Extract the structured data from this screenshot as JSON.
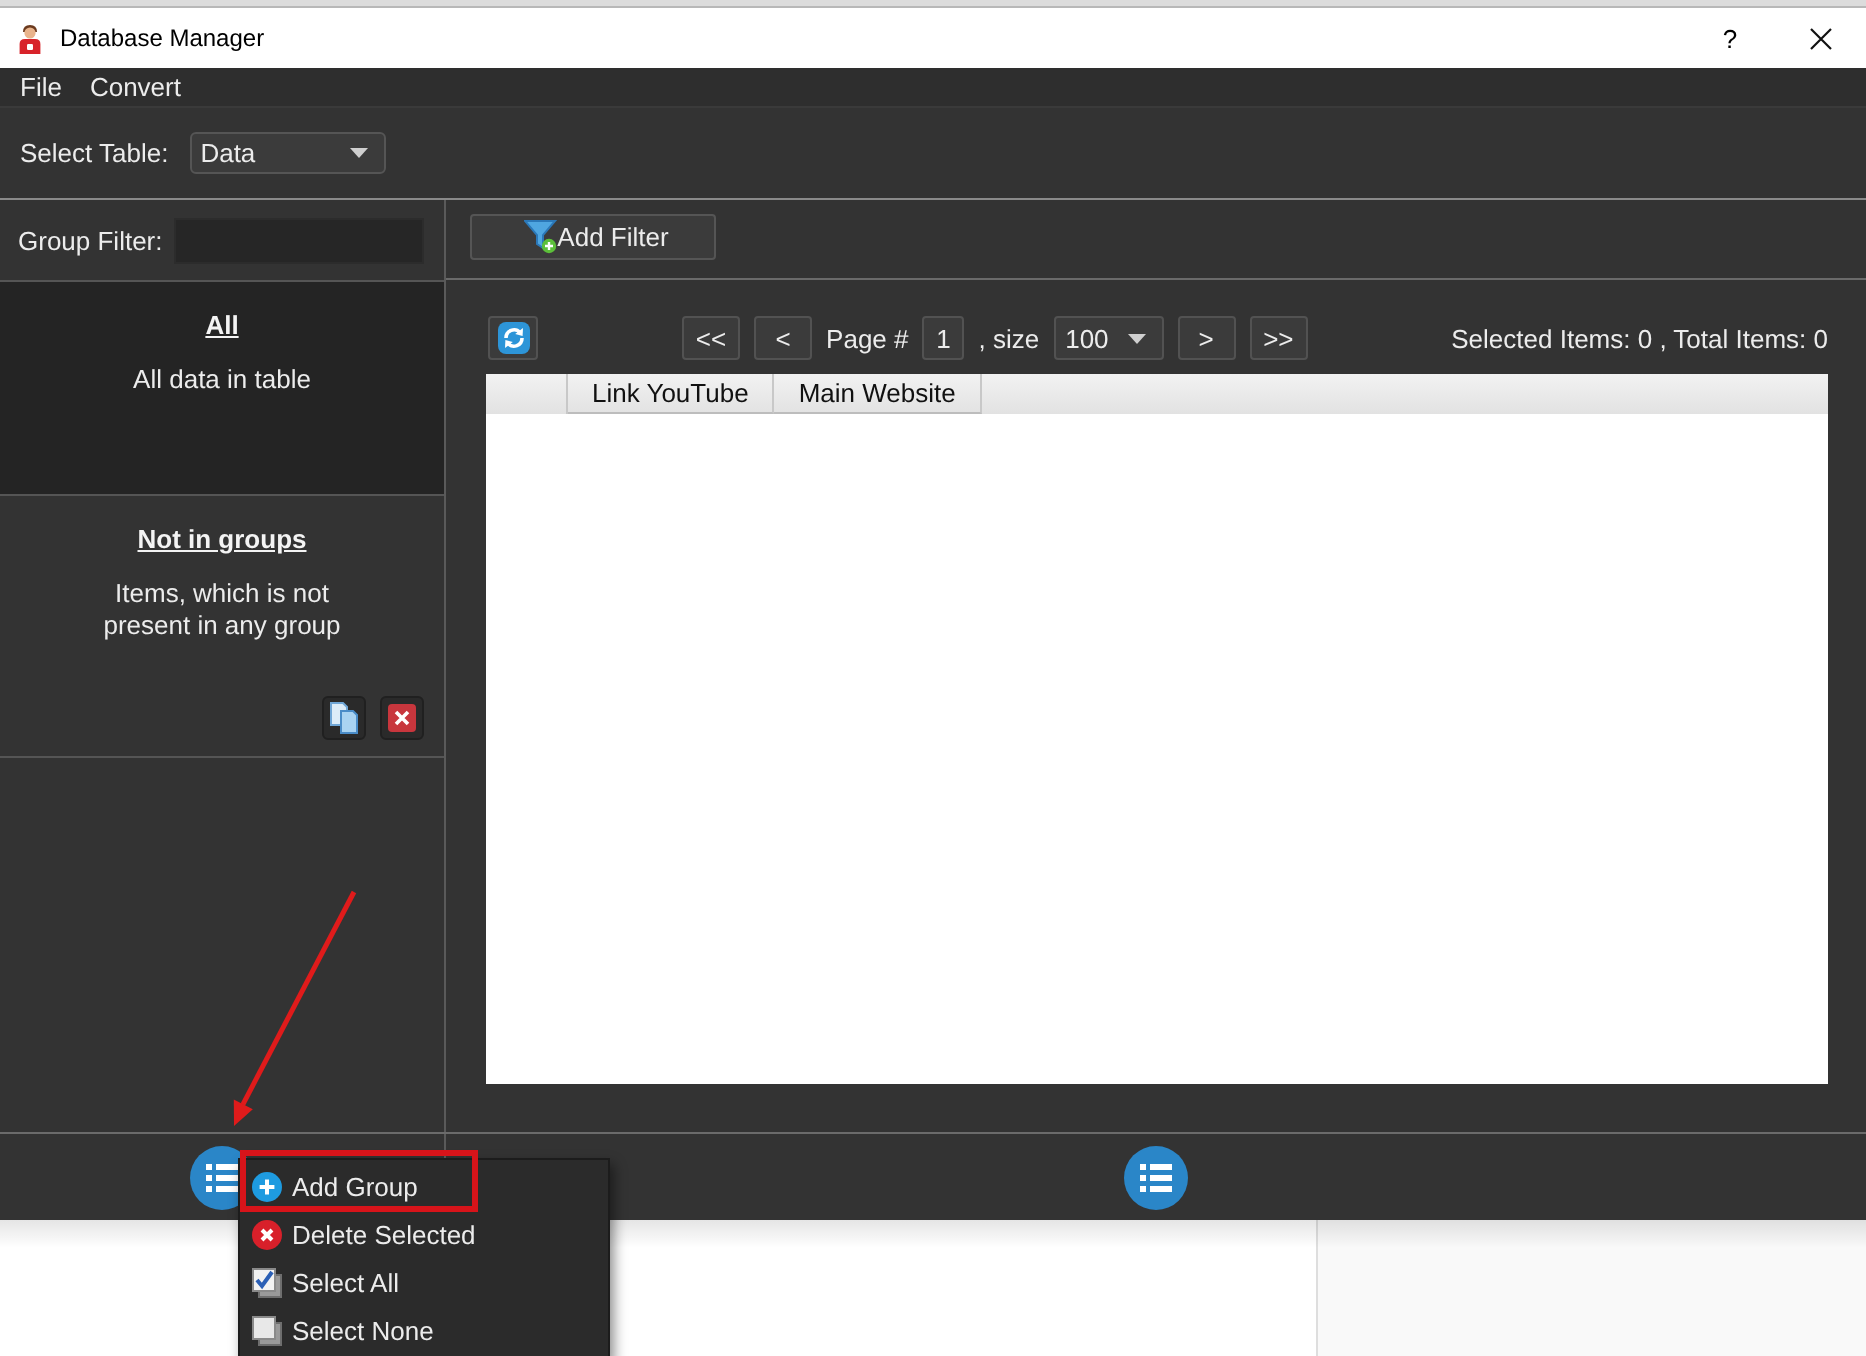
{
  "window": {
    "title": "Database Manager",
    "help": "?"
  },
  "menu_bar": [
    {
      "label": "File"
    },
    {
      "label": "Convert"
    }
  ],
  "toolbar": {
    "label": "Select Table:",
    "table_select": "Data"
  },
  "group_panel": {
    "filter_label": "Group Filter:",
    "groups": [
      {
        "title": "All",
        "description": "All data in table",
        "selected": true,
        "hovered": false
      },
      {
        "title": "Not in groups",
        "description": "Items, which is not present in any group",
        "selected": false,
        "hovered": true
      }
    ]
  },
  "data_panel": {
    "filter_button": "Add Filter",
    "pager": {
      "first": "<<",
      "previous": "<",
      "page_label": "Page #",
      "page": "1",
      "size_label": ", size",
      "size": "100",
      "next": ">",
      "last": ">>"
    },
    "status": "Selected Items: 0 , Total Items: 0",
    "table": {
      "columns": [
        "Link YouTube",
        "Main Website"
      ]
    }
  },
  "context_menu": {
    "items": [
      {
        "label": "Add Group",
        "kind": "add",
        "annotated": true
      },
      {
        "label": "Delete Selected",
        "kind": "delete",
        "annotated": false
      },
      {
        "label": "Select All",
        "kind": "select-all",
        "annotated": false
      },
      {
        "label": "Select None",
        "kind": "select-none",
        "annotated": false
      }
    ]
  }
}
